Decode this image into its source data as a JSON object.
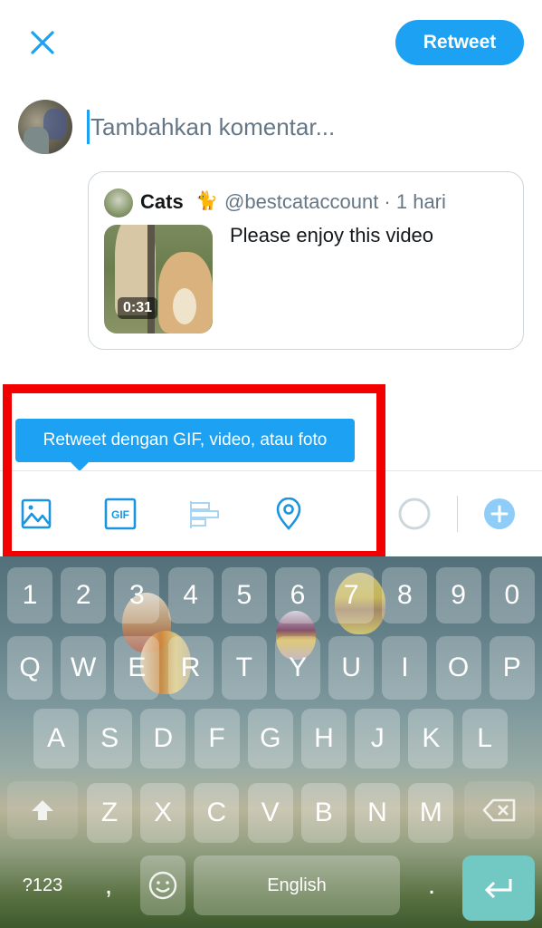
{
  "header": {
    "close_icon": "close-icon",
    "retweet_label": "Retweet"
  },
  "composer": {
    "placeholder": "Tambahkan komentar..."
  },
  "quoted_tweet": {
    "name": "Cats",
    "emoji": "🐈",
    "handle_time": "@bestcataccount · 1 hari",
    "text": "Please enjoy this video",
    "video_duration": "0:31"
  },
  "tooltip": {
    "text": "Retweet dengan GIF, video, atau foto"
  },
  "toolbar": {
    "items": [
      {
        "icon": "image-icon"
      },
      {
        "icon": "gif-icon",
        "label": "GIF"
      },
      {
        "icon": "poll-icon"
      },
      {
        "icon": "location-icon"
      },
      {
        "icon": "character-count-ring-icon"
      },
      {
        "icon": "add-tweet-icon"
      }
    ]
  },
  "colors": {
    "accent": "#1da1f2",
    "highlight": "#f20000",
    "enter_key": "#72c9c4"
  },
  "keyboard": {
    "row_numbers": [
      "1",
      "2",
      "3",
      "4",
      "5",
      "6",
      "7",
      "8",
      "9",
      "0"
    ],
    "row_q": [
      "Q",
      "W",
      "E",
      "R",
      "T",
      "Y",
      "U",
      "I",
      "O",
      "P"
    ],
    "row_a": [
      "A",
      "S",
      "D",
      "F",
      "G",
      "H",
      "J",
      "K",
      "L"
    ],
    "row_z": [
      "Z",
      "X",
      "C",
      "V",
      "B",
      "N",
      "M"
    ],
    "symbols_label": "?123",
    "comma": ",",
    "space_label": "English",
    "period": "."
  }
}
